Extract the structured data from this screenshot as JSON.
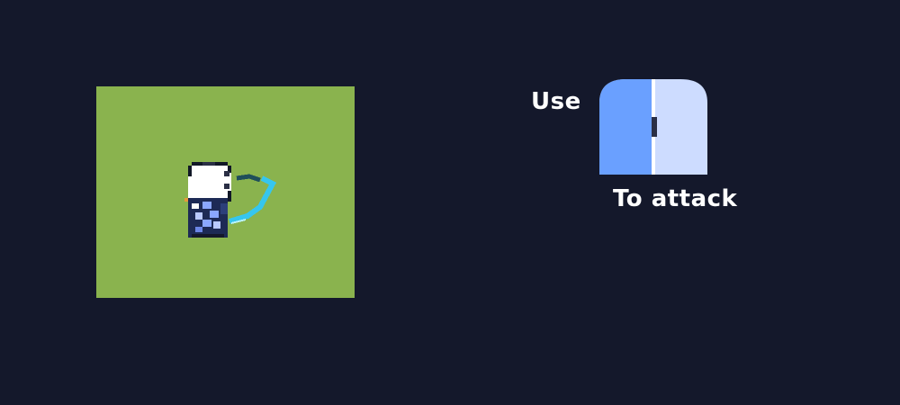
{
  "hint": {
    "use_label": "Use",
    "attack_label": "To attack",
    "input_icon": "left-mouse-button-icon"
  },
  "scene": {
    "ground_color": "#8ab34e",
    "player_icon": "player-character-sprite",
    "weapon_icon": "energy-whip-icon"
  },
  "colors": {
    "background": "#14182b",
    "mouse_left_button": "#6aa0ff",
    "mouse_right_button": "#cddcff"
  }
}
